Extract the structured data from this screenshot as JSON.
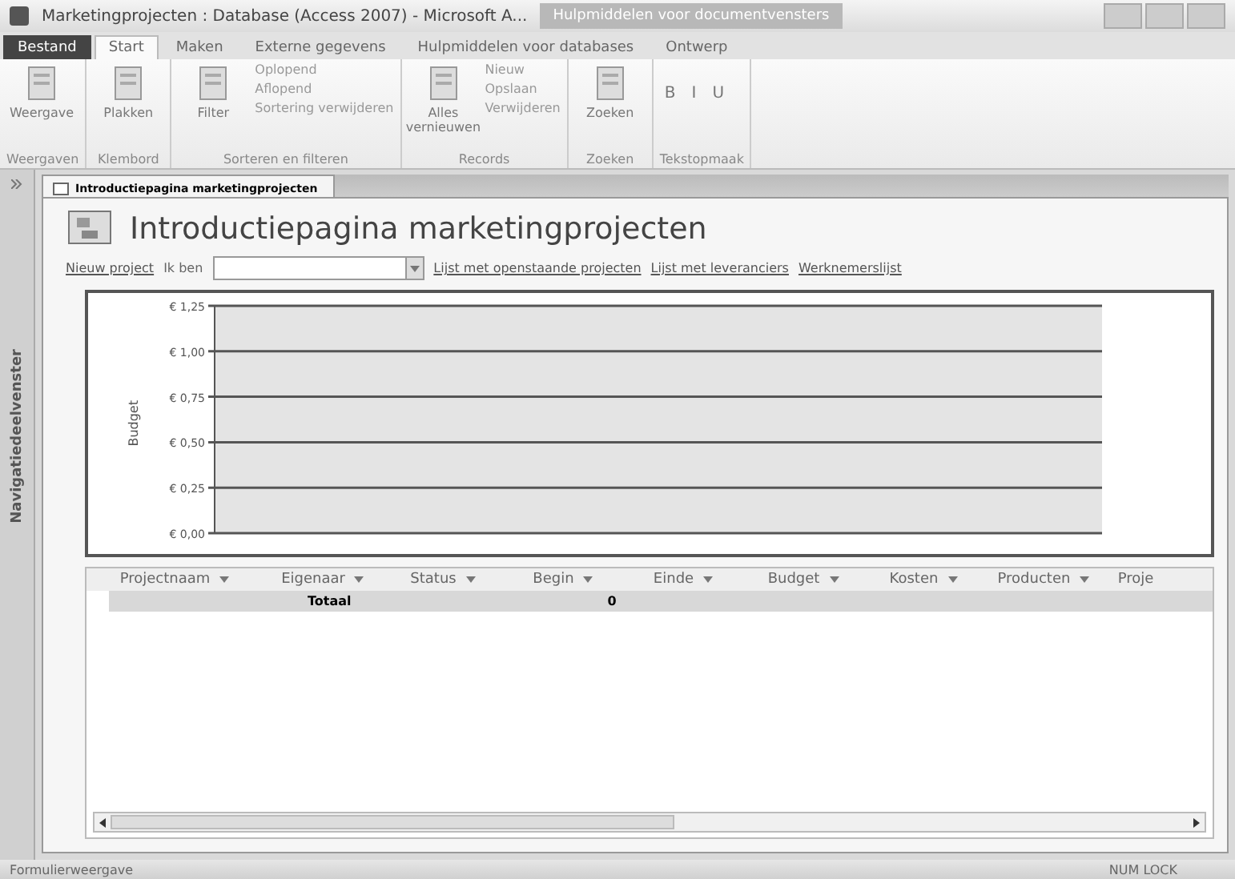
{
  "window": {
    "title": "Marketingprojecten : Database (Access 2007) - Microsoft A...",
    "context_tab": "Hulpmiddelen voor documentvensters"
  },
  "ribbon_tabs": [
    {
      "label": "Bestand",
      "kind": "file",
      "selected": false
    },
    {
      "label": "Start",
      "kind": "tab",
      "selected": true
    },
    {
      "label": "Maken",
      "kind": "tab",
      "selected": false
    },
    {
      "label": "Externe gegevens",
      "kind": "tab",
      "selected": false
    },
    {
      "label": "Hulpmiddelen voor databases",
      "kind": "tab",
      "selected": false
    },
    {
      "label": "Ontwerp",
      "kind": "tab",
      "selected": false
    }
  ],
  "ribbon_groups": [
    {
      "label": "Weergaven",
      "items": [
        {
          "label": "Weergave",
          "kind": "large"
        }
      ]
    },
    {
      "label": "Klembord",
      "items": [
        {
          "label": "Plakken",
          "kind": "large"
        }
      ]
    },
    {
      "label": "Sorteren en filteren",
      "items": [
        {
          "label": "Filter",
          "kind": "large"
        },
        {
          "label": "Oplopend",
          "kind": "small"
        },
        {
          "label": "Aflopend",
          "kind": "small"
        },
        {
          "label": "Sortering verwijderen",
          "kind": "small"
        }
      ]
    },
    {
      "label": "Records",
      "items": [
        {
          "label": "Alles vernieuwen",
          "kind": "large"
        },
        {
          "label": "Nieuw",
          "kind": "small"
        },
        {
          "label": "Opslaan",
          "kind": "small"
        },
        {
          "label": "Verwijderen",
          "kind": "small"
        }
      ]
    },
    {
      "label": "Zoeken",
      "items": [
        {
          "label": "Zoeken",
          "kind": "large"
        }
      ]
    },
    {
      "label": "Tekstopmaak",
      "items": [
        {
          "label": "B",
          "kind": "format"
        },
        {
          "label": "I",
          "kind": "format"
        },
        {
          "label": "U",
          "kind": "format"
        }
      ]
    }
  ],
  "navigation_pane": {
    "label": "Navigatiedeelvenster"
  },
  "document_tab": {
    "label": "Introductiepagina marketingprojecten"
  },
  "form": {
    "title": "Introductiepagina marketingprojecten",
    "links": [
      {
        "label": "Nieuw project",
        "kind": "link"
      },
      {
        "label": "Ik ben",
        "kind": "label"
      },
      {
        "kind": "combo"
      },
      {
        "label": "Lijst met openstaande projecten",
        "kind": "link"
      },
      {
        "label": "Lijst met leveranciers",
        "kind": "link"
      },
      {
        "label": "Werknemerslijst",
        "kind": "link"
      }
    ],
    "chart": {
      "ylabel": "Budget",
      "tick_labels": [
        "€ 1,25",
        "€ 1,00",
        "€ 0,75",
        "€ 0,50",
        "€ 0,25",
        "€ 0,00"
      ]
    },
    "table": {
      "columns": [
        "Projectnaam",
        "Eigenaar",
        "Status",
        "Begin",
        "Einde",
        "Budget",
        "Kosten",
        "Producten",
        "Proje"
      ],
      "totals": {
        "label": "Totaal",
        "count": "0"
      }
    }
  },
  "status_bar": {
    "left": "Formulierweergave",
    "right": "NUM LOCK"
  }
}
